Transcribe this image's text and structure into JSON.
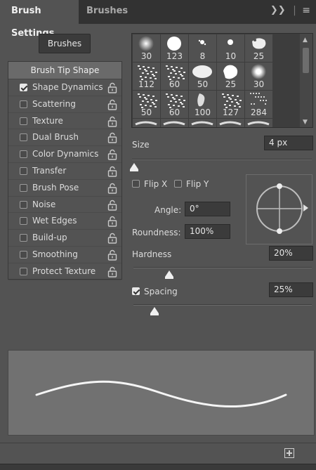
{
  "tabs": [
    {
      "label": "Brush Settings",
      "active": true
    },
    {
      "label": "Brushes",
      "active": false
    }
  ],
  "header_tools": {
    "expand_icon": "double-chevron-right-icon",
    "menu_icon": "hamburger-menu-icon"
  },
  "brushes_button": "Brushes",
  "options": {
    "header": "Brush Tip Shape",
    "items": [
      {
        "label": "Shape Dynamics",
        "checked": true
      },
      {
        "label": "Scattering",
        "checked": false
      },
      {
        "label": "Texture",
        "checked": false
      },
      {
        "label": "Dual Brush",
        "checked": false
      },
      {
        "label": "Color Dynamics",
        "checked": false
      },
      {
        "label": "Transfer",
        "checked": false
      },
      {
        "label": "Brush Pose",
        "checked": false
      },
      {
        "label": "Noise",
        "checked": false
      },
      {
        "label": "Wet Edges",
        "checked": false
      },
      {
        "label": "Build-up",
        "checked": false
      },
      {
        "label": "Smoothing",
        "checked": false
      },
      {
        "label": "Protect Texture",
        "checked": false
      }
    ]
  },
  "brush_grid": {
    "sizes": [
      "30",
      "123",
      "8",
      "10",
      "25",
      "112",
      "60",
      "50",
      "25",
      "30",
      "50",
      "60",
      "100",
      "127",
      "284"
    ]
  },
  "size": {
    "label": "Size",
    "value": "4 px",
    "level": 0.01
  },
  "flip_x": {
    "label": "Flip X",
    "checked": false
  },
  "flip_y": {
    "label": "Flip Y",
    "checked": false
  },
  "angle": {
    "label": "Angle:",
    "value": "0°"
  },
  "roundness": {
    "label": "Roundness:",
    "value": "100%"
  },
  "hardness": {
    "label": "Hardness",
    "value": "20%",
    "level": 0.2
  },
  "spacing": {
    "label": "Spacing",
    "value": "25%",
    "checked": true,
    "level": 0.12
  },
  "new_brush_icon": "new-brush-icon"
}
